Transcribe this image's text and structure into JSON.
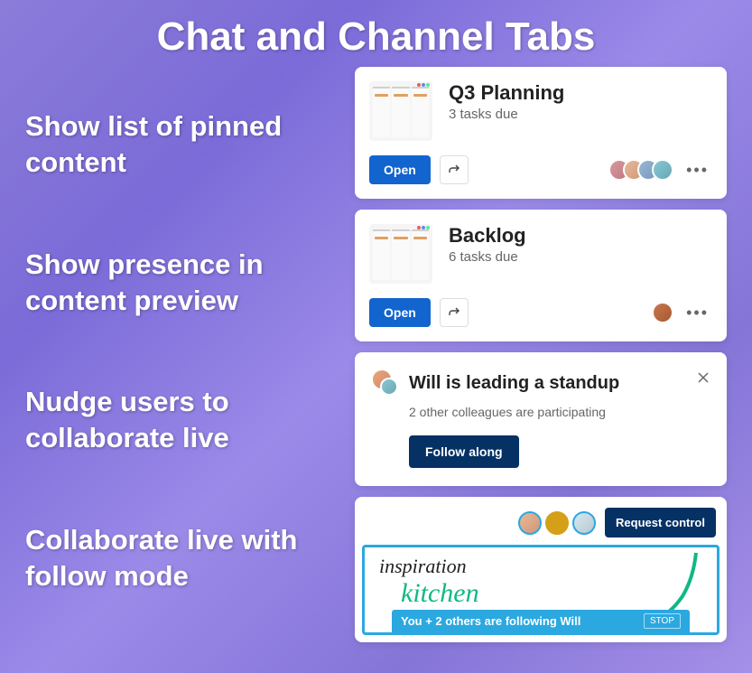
{
  "title": "Chat and Channel Tabs",
  "features": [
    "Show list of pinned content",
    "Show presence in content preview",
    "Nudge users to collaborate live",
    "Collaborate live with follow mode"
  ],
  "cards": [
    {
      "title": "Q3 Planning",
      "subtitle": "3 tasks due",
      "open_label": "Open",
      "avatars": [
        {
          "bg": "linear-gradient(135deg,#d898a0,#c07880)"
        },
        {
          "bg": "linear-gradient(135deg,#e8b898,#d09878)"
        },
        {
          "bg": "linear-gradient(135deg,#98b8d8,#7898b8)"
        },
        {
          "bg": "linear-gradient(135deg,#88c8d4,#68a8b4)"
        }
      ]
    },
    {
      "title": "Backlog",
      "subtitle": "6 tasks due",
      "open_label": "Open",
      "avatars": [
        {
          "bg": "linear-gradient(135deg,#c87850,#a85830)"
        }
      ]
    }
  ],
  "standup": {
    "title": "Will is leading a standup",
    "subtitle": "2 other colleagues are participating",
    "follow_label": "Follow along"
  },
  "whiteboard": {
    "request_label": "Request control",
    "text1": "inspiration",
    "text2": "kitchen",
    "banner_text": "You + 2 others are following Will",
    "stop_label": "STOP",
    "avatars": [
      {
        "border": "#2ba8e0",
        "bg": "linear-gradient(135deg,#e8b898,#d09878)"
      },
      {
        "border": "#d4a018",
        "bg": "#d4a018"
      },
      {
        "border": "#2ba8e0",
        "bg": "linear-gradient(135deg,#d8e8f0,#b8c8d0)"
      }
    ]
  }
}
